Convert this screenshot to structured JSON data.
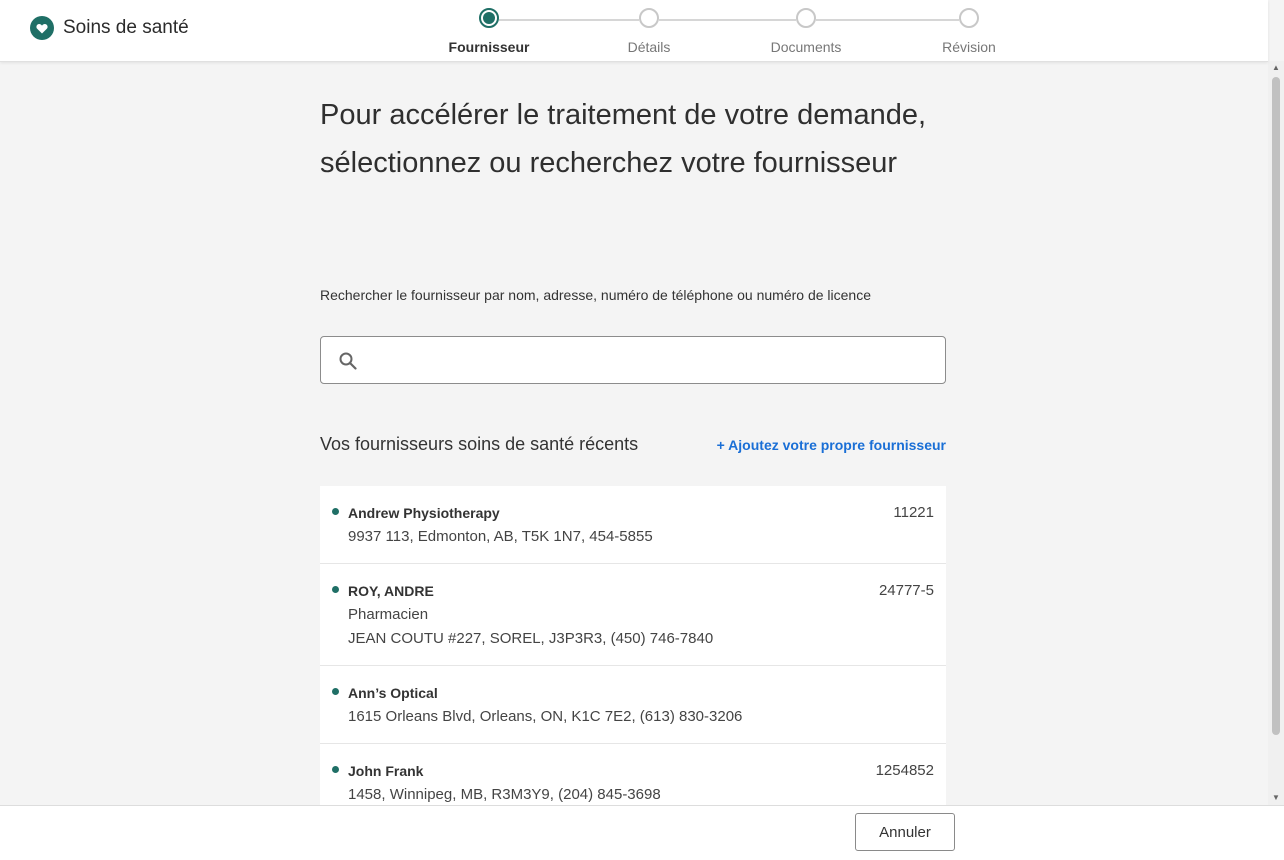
{
  "app": {
    "title": "Soins de santé",
    "brand_icon": "heart-icon",
    "accent_color": "#1f6f66"
  },
  "stepper": {
    "steps": [
      {
        "label": "Fournisseur",
        "state": "active"
      },
      {
        "label": "Détails",
        "state": "upcoming"
      },
      {
        "label": "Documents",
        "state": "upcoming"
      },
      {
        "label": "Révision",
        "state": "upcoming"
      }
    ]
  },
  "main": {
    "title": "Pour accélérer le traitement de votre demande, sélectionnez ou recherchez votre fournisseur",
    "search": {
      "label": "Rechercher le fournisseur par nom, adresse, numéro de téléphone ou numéro de licence",
      "value": "",
      "placeholder": "",
      "icon": "search-icon"
    },
    "recent": {
      "title": "Vos fournisseurs soins de santé récents",
      "add_link": "+ Ajoutez votre propre fournisseur",
      "link_color": "#1a6fd6"
    },
    "providers": [
      {
        "name": "Andrew Physiotherapy",
        "lines": [
          "9937 113, Edmonton, AB, T5K 1N7, 454-5855"
        ],
        "number": "11221"
      },
      {
        "name": "ROY, ANDRE",
        "lines": [
          "Pharmacien",
          "JEAN COUTU #227, SOREL, J3P3R3, (450) 746-7840"
        ],
        "number": "24777-5"
      },
      {
        "name": "Ann’s Optical",
        "lines": [
          "1615 Orleans Blvd, Orleans, ON, K1C 7E2, (613) 830-3206"
        ],
        "number": ""
      },
      {
        "name": "John Frank",
        "lines": [
          "1458, Winnipeg, MB, R3M3Y9, (204) 845-3698"
        ],
        "number": "1254852"
      }
    ]
  },
  "footer": {
    "cancel_label": "Annuler"
  }
}
